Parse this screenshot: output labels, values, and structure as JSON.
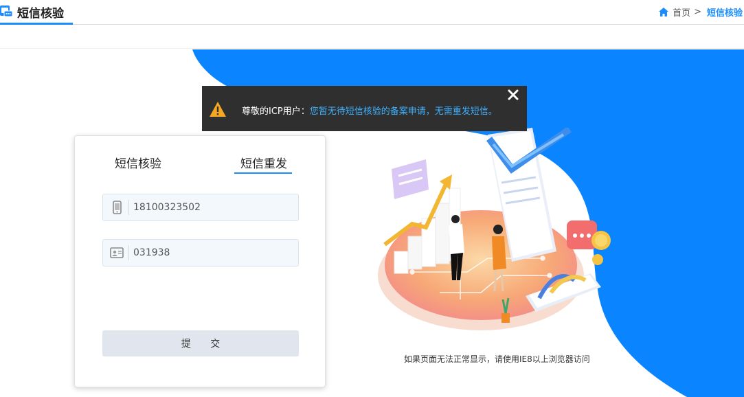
{
  "header": {
    "title": "短信核验",
    "breadcrumb": {
      "home": "首页",
      "separator": ">",
      "current": "短信核验"
    }
  },
  "alert": {
    "label": "尊敬的ICP用户：",
    "message": "您暂无待短信核验的备案申请，无需重发短信。",
    "close_icon": "close-icon",
    "warning_icon": "warning-icon"
  },
  "card": {
    "tabs": [
      {
        "label": "短信核验",
        "active": false
      },
      {
        "label": "短信重发",
        "active": true
      }
    ],
    "phone_field": {
      "value": "18100323502",
      "icon": "mobile-phone-icon"
    },
    "code_field": {
      "value": "031938",
      "icon": "id-card-icon"
    },
    "submit_label": "提 交"
  },
  "footer_note": "如果页面无法正常显示，请使用IE8以上浏览器访问",
  "colors": {
    "accent": "#1a8cff",
    "alert_bg": "#2f2f2f",
    "alert_message": "#3fb2ff",
    "warning": "#f5a623",
    "bg_blob": "#0a84ff",
    "button_bg": "#e1e5ee"
  }
}
